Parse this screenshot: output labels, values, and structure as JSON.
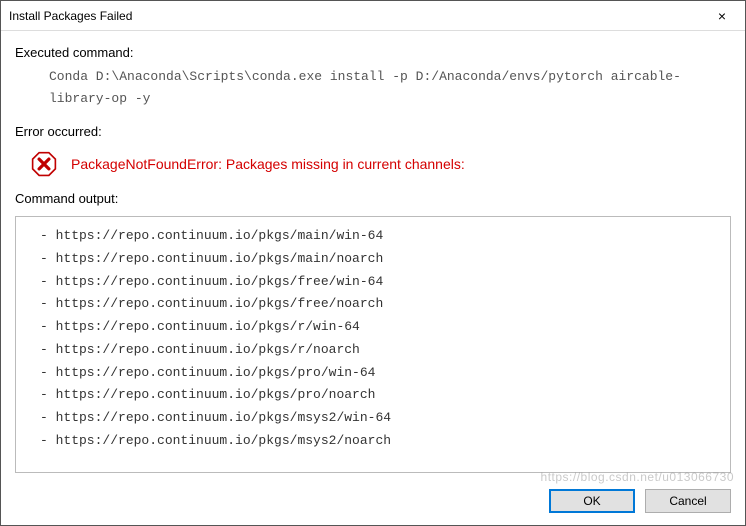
{
  "titlebar": {
    "title": "Install Packages Failed",
    "close_icon": "×"
  },
  "sections": {
    "executed_label": "Executed command:",
    "error_label": "Error occurred:",
    "output_label": "Command output:"
  },
  "command": "Conda D:\\Anaconda\\Scripts\\conda.exe install -p D:/Anaconda/envs/pytorch aircable-library-op -y",
  "error_message": "PackageNotFoundError: Packages missing in current channels:",
  "output_lines": [
    "- https://repo.continuum.io/pkgs/main/win-64",
    "- https://repo.continuum.io/pkgs/main/noarch",
    "- https://repo.continuum.io/pkgs/free/win-64",
    "- https://repo.continuum.io/pkgs/free/noarch",
    "- https://repo.continuum.io/pkgs/r/win-64",
    "- https://repo.continuum.io/pkgs/r/noarch",
    "- https://repo.continuum.io/pkgs/pro/win-64",
    "- https://repo.continuum.io/pkgs/pro/noarch",
    "- https://repo.continuum.io/pkgs/msys2/win-64",
    "- https://repo.continuum.io/pkgs/msys2/noarch"
  ],
  "buttons": {
    "ok": "OK",
    "cancel": "Cancel"
  },
  "watermark": "https://blog.csdn.net/u013066730"
}
